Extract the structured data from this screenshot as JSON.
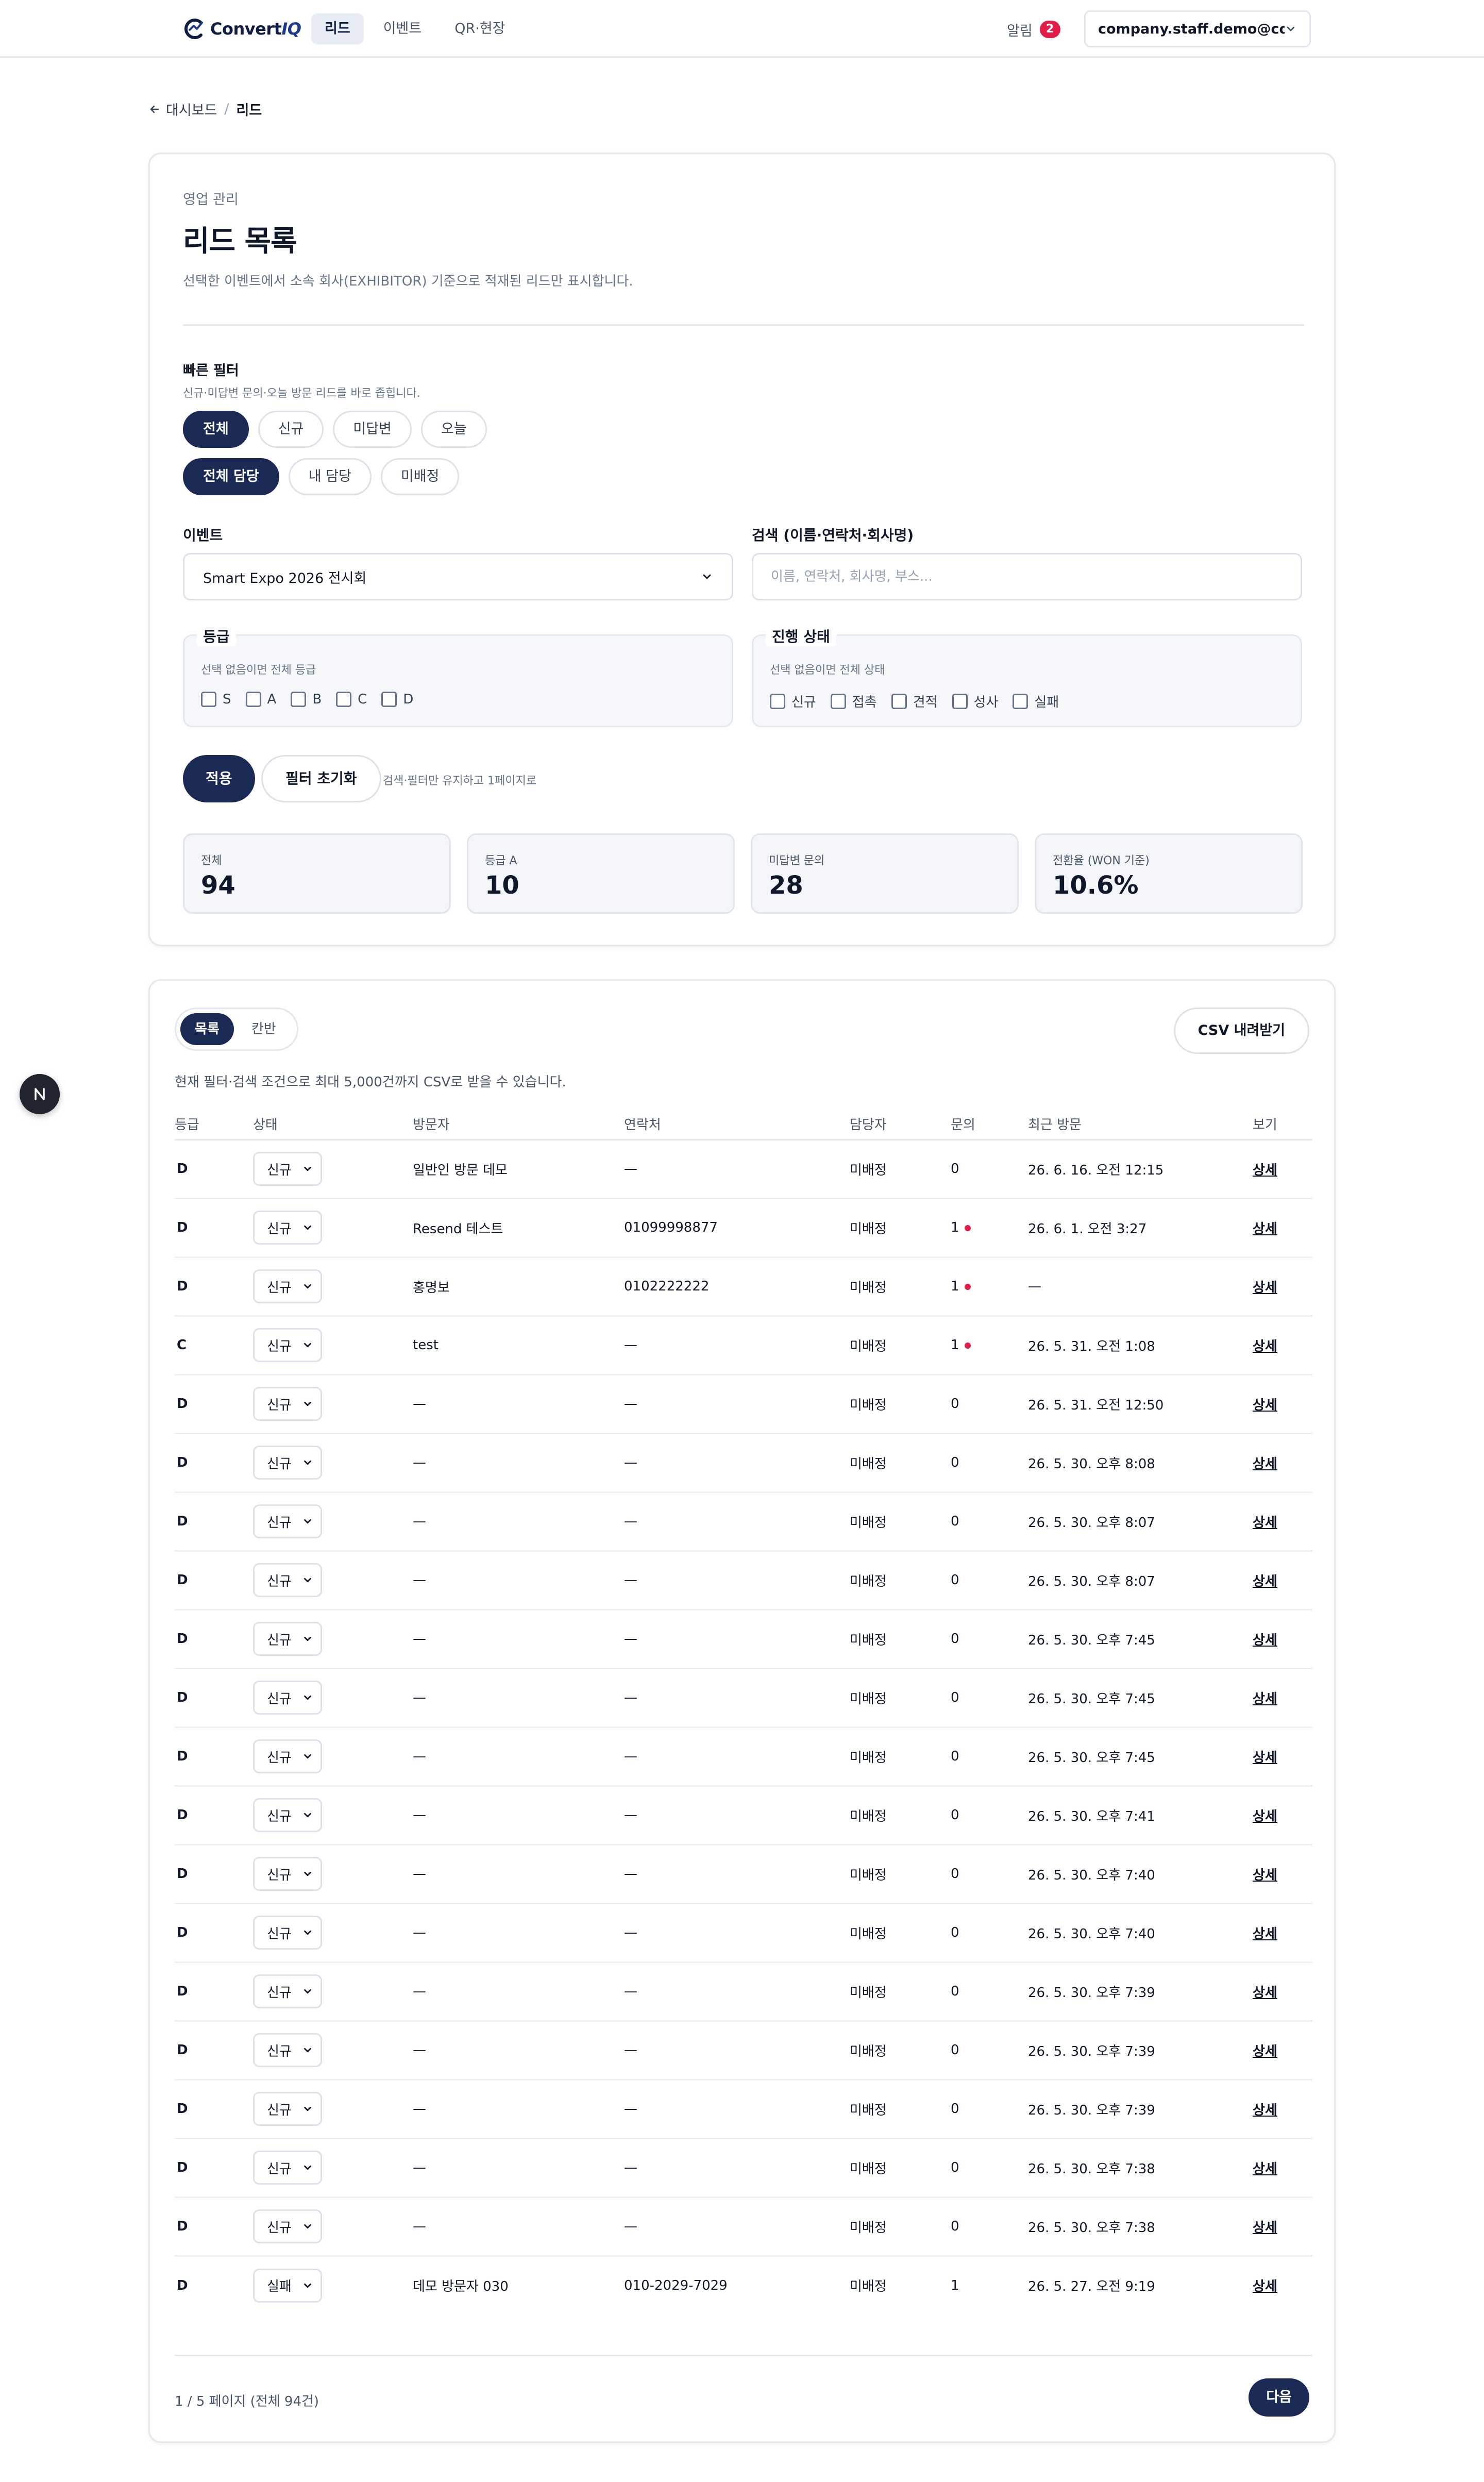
{
  "header": {
    "logo_text": "Convert",
    "logo_text_accent": "IQ",
    "nav": [
      {
        "label": "리드",
        "active": true
      },
      {
        "label": "이벤트",
        "active": false
      },
      {
        "label": "QR·현장",
        "active": false
      }
    ],
    "alerts_label": "알림",
    "alerts_count": "2",
    "account": "company.staff.demo@co..."
  },
  "breadcrumb": {
    "back": "대시보드",
    "separator": "/",
    "current": "리드"
  },
  "filters": {
    "eyebrow": "영업 관리",
    "title": "리드 목록",
    "subtitle": "선택한 이벤트에서 소속 회사(EXHIBITOR) 기준으로 적재된 리드만 표시합니다.",
    "quick_label": "빠른 필터",
    "quick_sub": "신규·미답변 문의·오늘 방문 리드를 바로 좁힙니다.",
    "quick_pills": [
      "전체",
      "신규",
      "미답변",
      "오늘"
    ],
    "owner_pills": [
      "전체 담당",
      "내 담당",
      "미배정"
    ],
    "event_label": "이벤트",
    "event_value": "Smart Expo 2026 전시회",
    "search_label": "검색 (이름·연락처·회사명)",
    "search_placeholder": "이름, 연락처, 회사명, 부스...",
    "grade_legend": "등급",
    "grade_hint": "선택 없음이면 전체 등급",
    "grades": [
      "S",
      "A",
      "B",
      "C",
      "D"
    ],
    "status_legend": "진행 상태",
    "status_hint": "선택 없음이면 전체 상태",
    "statuses": [
      "신규",
      "접촉",
      "견적",
      "성사",
      "실패"
    ],
    "apply_label": "적용",
    "reset_label": "필터 초기화",
    "reset_hint": "검색·필터만 유지하고 1페이지로"
  },
  "stats": [
    {
      "label": "전체",
      "value": "94"
    },
    {
      "label": "등급 A",
      "value": "10"
    },
    {
      "label": "미답변 문의",
      "value": "28"
    },
    {
      "label": "전환율 (WON 기준)",
      "value": "10.6%"
    }
  ],
  "list": {
    "view_list": "목록",
    "view_kanban": "칸반",
    "csv_label": "CSV 내려받기",
    "csv_note": "현재 필터·검색 조건으로 최대 5,000건까지 CSV로 받을 수 있습니다.",
    "columns": [
      "등급",
      "상태",
      "방문자",
      "연락처",
      "담당자",
      "문의",
      "최근 방문",
      "보기"
    ],
    "rows": [
      {
        "grade": "D",
        "status": "신규",
        "visitor": "일반인 방문 데모",
        "contact": "—",
        "owner": "미배정",
        "inquiries": "0",
        "unread": false,
        "last_visit": "26. 6. 16. 오전 12:15",
        "view": "상세"
      },
      {
        "grade": "D",
        "status": "신규",
        "visitor": "Resend 테스트",
        "contact": "01099998877",
        "owner": "미배정",
        "inquiries": "1",
        "unread": true,
        "last_visit": "26. 6. 1. 오전 3:27",
        "view": "상세"
      },
      {
        "grade": "D",
        "status": "신규",
        "visitor": "홍명보",
        "contact": "0102222222",
        "owner": "미배정",
        "inquiries": "1",
        "unread": true,
        "last_visit": "—",
        "view": "상세"
      },
      {
        "grade": "C",
        "status": "신규",
        "visitor": "test",
        "contact": "—",
        "owner": "미배정",
        "inquiries": "1",
        "unread": true,
        "last_visit": "26. 5. 31. 오전 1:08",
        "view": "상세"
      },
      {
        "grade": "D",
        "status": "신규",
        "visitor": "—",
        "contact": "—",
        "owner": "미배정",
        "inquiries": "0",
        "unread": false,
        "last_visit": "26. 5. 31. 오전 12:50",
        "view": "상세"
      },
      {
        "grade": "D",
        "status": "신규",
        "visitor": "—",
        "contact": "—",
        "owner": "미배정",
        "inquiries": "0",
        "unread": false,
        "last_visit": "26. 5. 30. 오후 8:08",
        "view": "상세"
      },
      {
        "grade": "D",
        "status": "신규",
        "visitor": "—",
        "contact": "—",
        "owner": "미배정",
        "inquiries": "0",
        "unread": false,
        "last_visit": "26. 5. 30. 오후 8:07",
        "view": "상세"
      },
      {
        "grade": "D",
        "status": "신규",
        "visitor": "—",
        "contact": "—",
        "owner": "미배정",
        "inquiries": "0",
        "unread": false,
        "last_visit": "26. 5. 30. 오후 8:07",
        "view": "상세"
      },
      {
        "grade": "D",
        "status": "신규",
        "visitor": "—",
        "contact": "—",
        "owner": "미배정",
        "inquiries": "0",
        "unread": false,
        "last_visit": "26. 5. 30. 오후 7:45",
        "view": "상세"
      },
      {
        "grade": "D",
        "status": "신규",
        "visitor": "—",
        "contact": "—",
        "owner": "미배정",
        "inquiries": "0",
        "unread": false,
        "last_visit": "26. 5. 30. 오후 7:45",
        "view": "상세"
      },
      {
        "grade": "D",
        "status": "신규",
        "visitor": "—",
        "contact": "—",
        "owner": "미배정",
        "inquiries": "0",
        "unread": false,
        "last_visit": "26. 5. 30. 오후 7:45",
        "view": "상세"
      },
      {
        "grade": "D",
        "status": "신규",
        "visitor": "—",
        "contact": "—",
        "owner": "미배정",
        "inquiries": "0",
        "unread": false,
        "last_visit": "26. 5. 30. 오후 7:41",
        "view": "상세"
      },
      {
        "grade": "D",
        "status": "신규",
        "visitor": "—",
        "contact": "—",
        "owner": "미배정",
        "inquiries": "0",
        "unread": false,
        "last_visit": "26. 5. 30. 오후 7:40",
        "view": "상세"
      },
      {
        "grade": "D",
        "status": "신규",
        "visitor": "—",
        "contact": "—",
        "owner": "미배정",
        "inquiries": "0",
        "unread": false,
        "last_visit": "26. 5. 30. 오후 7:40",
        "view": "상세"
      },
      {
        "grade": "D",
        "status": "신규",
        "visitor": "—",
        "contact": "—",
        "owner": "미배정",
        "inquiries": "0",
        "unread": false,
        "last_visit": "26. 5. 30. 오후 7:39",
        "view": "상세"
      },
      {
        "grade": "D",
        "status": "신규",
        "visitor": "—",
        "contact": "—",
        "owner": "미배정",
        "inquiries": "0",
        "unread": false,
        "last_visit": "26. 5. 30. 오후 7:39",
        "view": "상세"
      },
      {
        "grade": "D",
        "status": "신규",
        "visitor": "—",
        "contact": "—",
        "owner": "미배정",
        "inquiries": "0",
        "unread": false,
        "last_visit": "26. 5. 30. 오후 7:39",
        "view": "상세"
      },
      {
        "grade": "D",
        "status": "신규",
        "visitor": "—",
        "contact": "—",
        "owner": "미배정",
        "inquiries": "0",
        "unread": false,
        "last_visit": "26. 5. 30. 오후 7:38",
        "view": "상세"
      },
      {
        "grade": "D",
        "status": "신규",
        "visitor": "—",
        "contact": "—",
        "owner": "미배정",
        "inquiries": "0",
        "unread": false,
        "last_visit": "26. 5. 30. 오후 7:38",
        "view": "상세"
      },
      {
        "grade": "D",
        "status": "실패",
        "visitor": "데모 방문자 030",
        "contact": "010-2029-7029",
        "owner": "미배정",
        "inquiries": "1",
        "unread": false,
        "last_visit": "26. 5. 27. 오전 9:19",
        "view": "상세"
      }
    ],
    "pagination": "1 / 5 페이지 (전체 94건)",
    "next_label": "다음"
  },
  "colors": {
    "primary": "#1b2a54",
    "alert": "#e11d48",
    "muted_text": "#64748b",
    "border": "#dde2ea"
  },
  "icons": {
    "logo": "convertiq-logo-icon",
    "account_dropdown": "chevron-down-icon",
    "back": "arrow-left-icon",
    "unread": "unread-dot-icon",
    "dev_badge": "nextjs-logo-icon"
  }
}
